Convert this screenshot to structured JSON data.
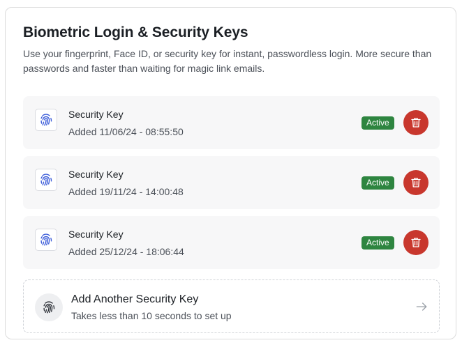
{
  "section": {
    "title": "Biometric Login & Security Keys",
    "description": "Use your fingerprint, Face ID, or security key for instant, passwordless login. More secure than passwords and faster than waiting for magic link emails."
  },
  "keys": [
    {
      "name": "Security Key",
      "added": "Added 11/06/24 - 08:55:50",
      "status": "Active",
      "icon": "fingerprint-icon"
    },
    {
      "name": "Security Key",
      "added": "Added 19/11/24 - 14:00:48",
      "status": "Active",
      "icon": "fingerprint-icon"
    },
    {
      "name": "Security Key",
      "added": "Added 25/12/24 - 18:06:44",
      "status": "Active",
      "icon": "fingerprint-icon"
    }
  ],
  "add_key": {
    "title": "Add Another Security Key",
    "subtitle": "Takes less than 10 seconds to set up",
    "icon": "fingerprint-icon",
    "action_icon": "arrow-right-icon"
  },
  "colors": {
    "active_badge": "#2e8540",
    "delete_button": "#c8372d",
    "fingerprint_accent": "#3a5bd9"
  }
}
